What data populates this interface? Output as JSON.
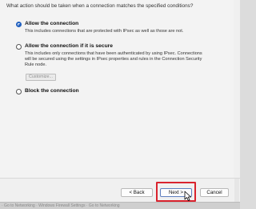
{
  "dialog": {
    "question": "What action should be taken when a connection matches the specified conditions?",
    "options": [
      {
        "label": "Allow the connection",
        "description": [
          "This includes connections that are protected with IPsec as well as those are not."
        ],
        "checked": true
      },
      {
        "label": "Allow the connection if it is secure",
        "description": [
          "This includes only connections that have been authenticated by using IPsec.  Connections",
          "will be secured using the settings in IPsec properties and rules in the Connection Security",
          "Rule node."
        ],
        "checked": false
      },
      {
        "label": "Block the connection",
        "description": [],
        "checked": false
      }
    ],
    "customize_label": "Customize...",
    "buttons": {
      "back": "< Back",
      "next": "Next >",
      "cancel": "Cancel"
    },
    "highlight_color": "#d9232e",
    "accent_color": "#1f5fbf"
  },
  "taskbar": {
    "text": "· Go to Networking  · Windows Firewall Settings  · Go to Networking"
  }
}
